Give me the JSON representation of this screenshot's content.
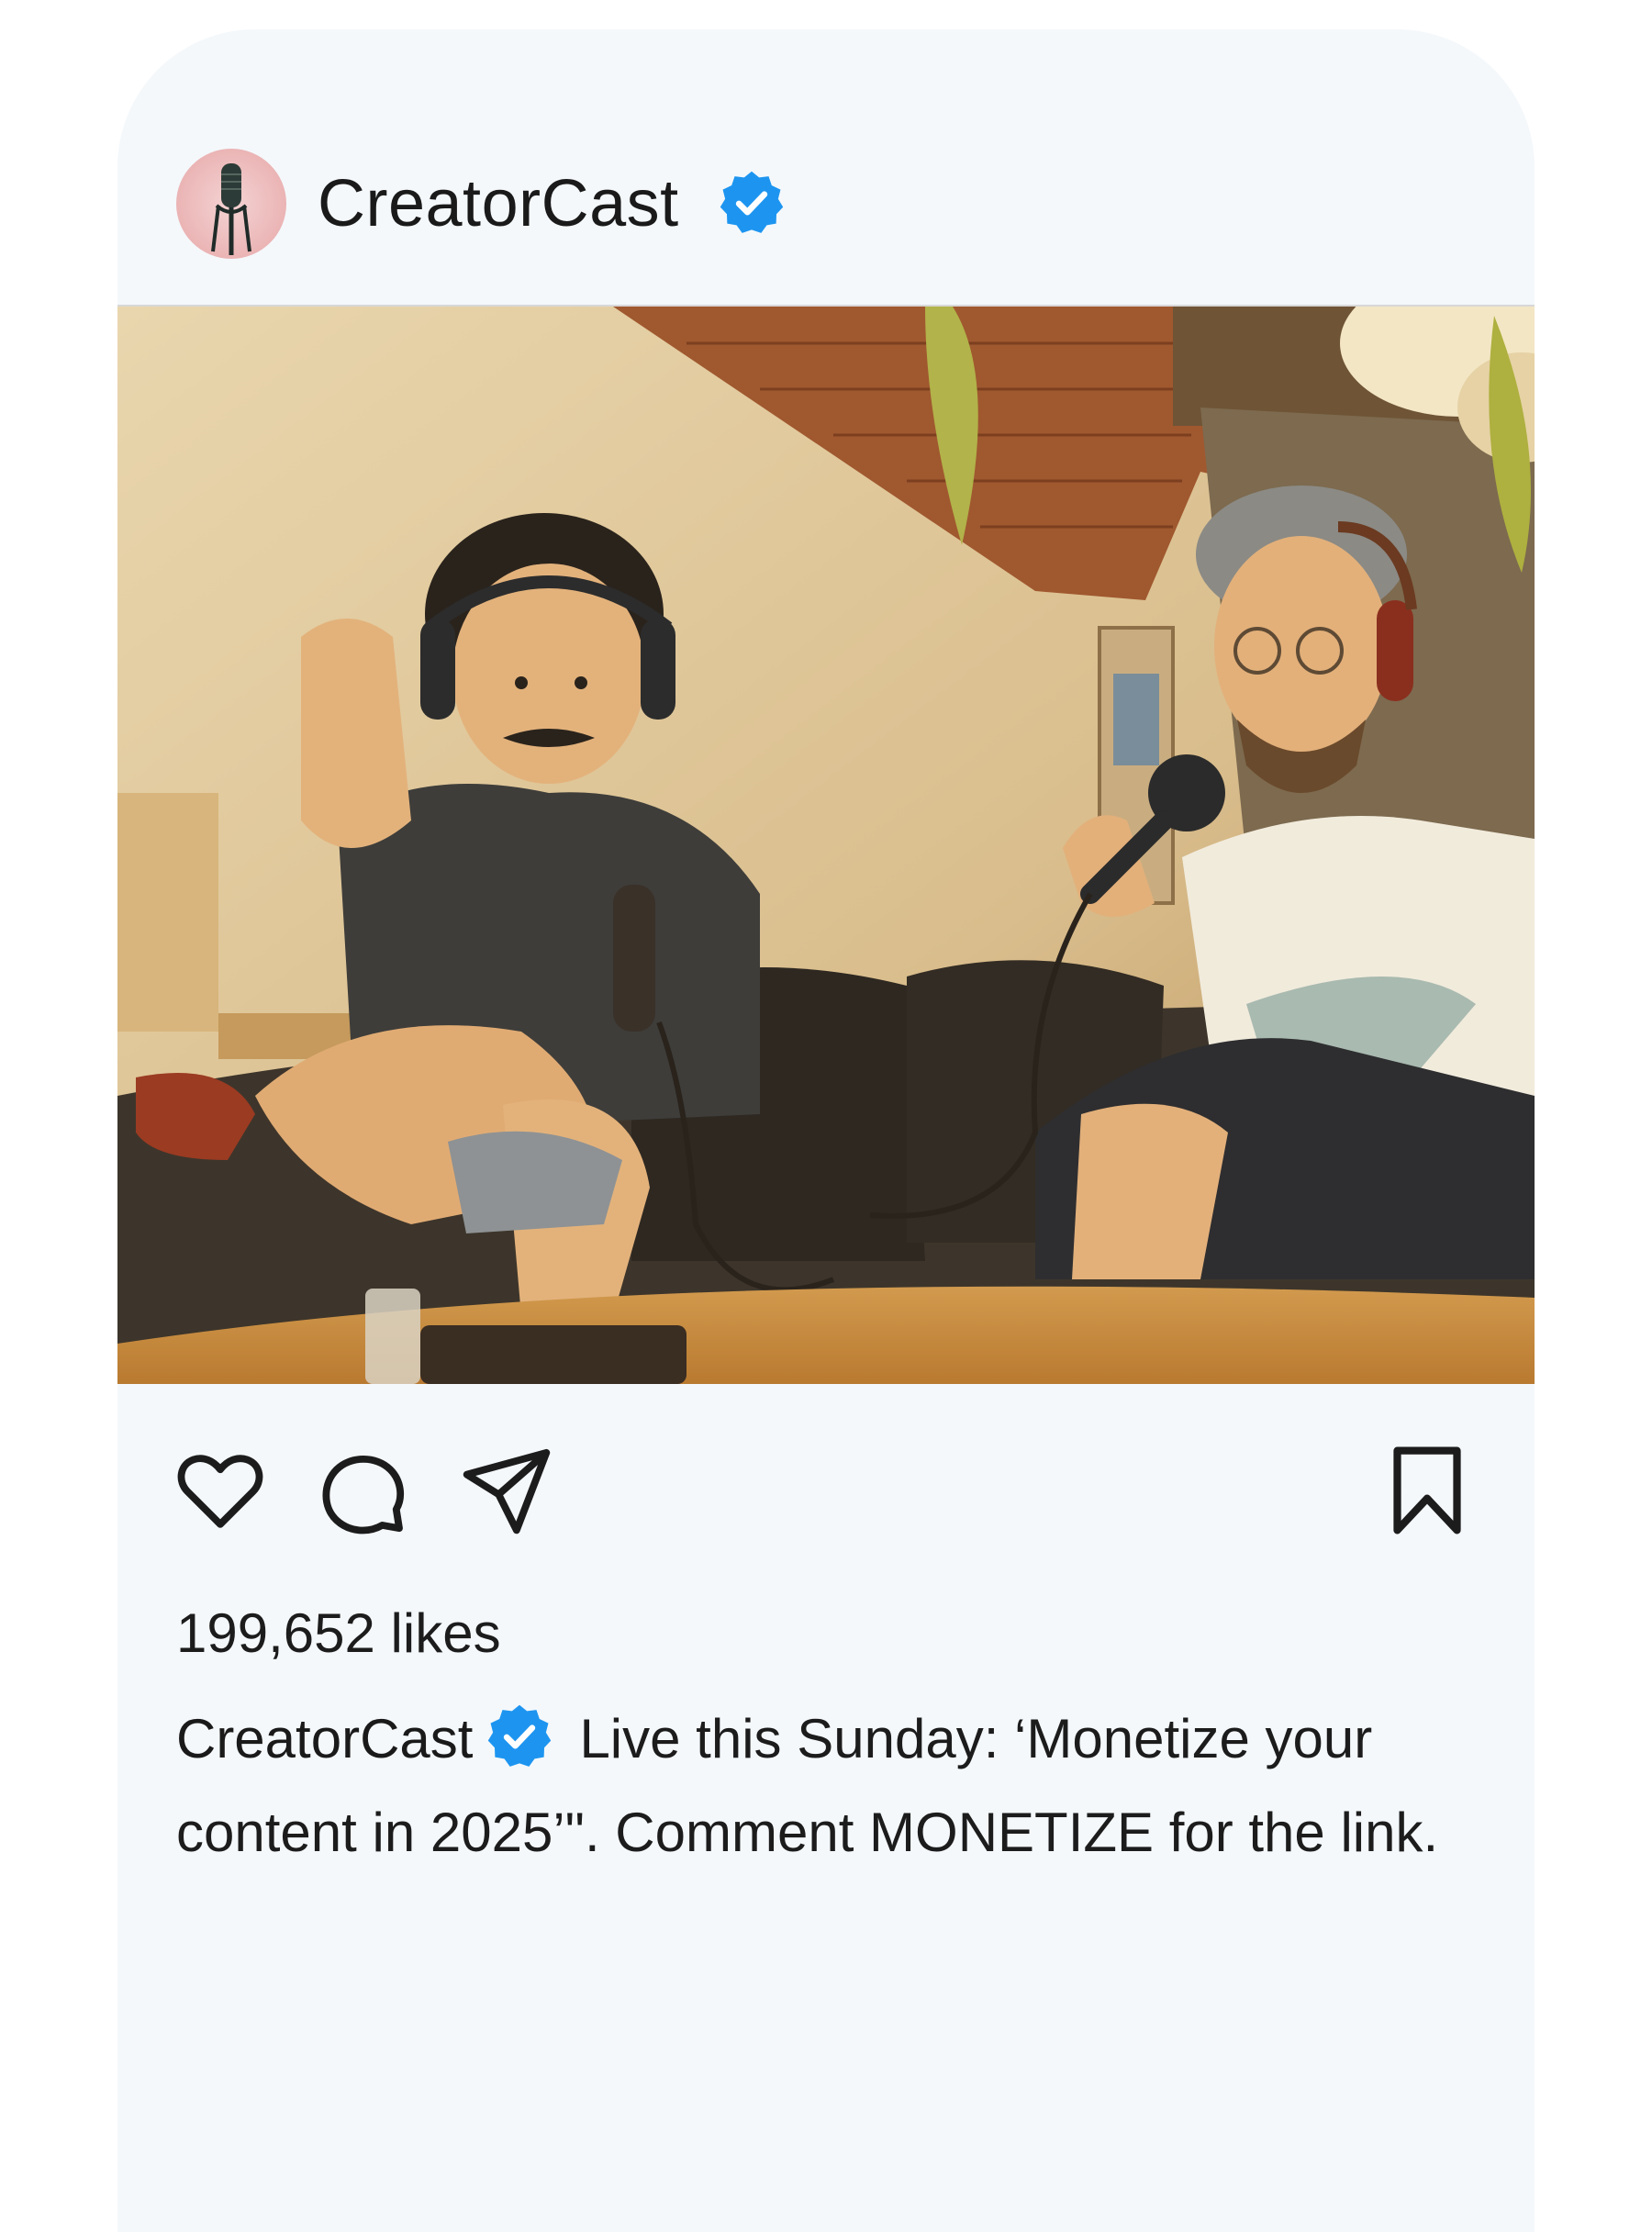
{
  "post": {
    "username": "CreatorCast",
    "verified": true,
    "avatar_icon": "microphone-icon",
    "likes_text": "199,652 likes",
    "caption_text": "Live this Sunday: ‘Monetize your content in 2025’\". Comment MONETIZE for the link."
  },
  "actions": {
    "like_icon": "heart-icon",
    "comment_icon": "comment-icon",
    "share_icon": "send-icon",
    "save_icon": "bookmark-icon"
  },
  "colors": {
    "verified_blue": "#1d95f0",
    "card_background": "#f4f8fb",
    "avatar_background": "#eab3b4"
  }
}
